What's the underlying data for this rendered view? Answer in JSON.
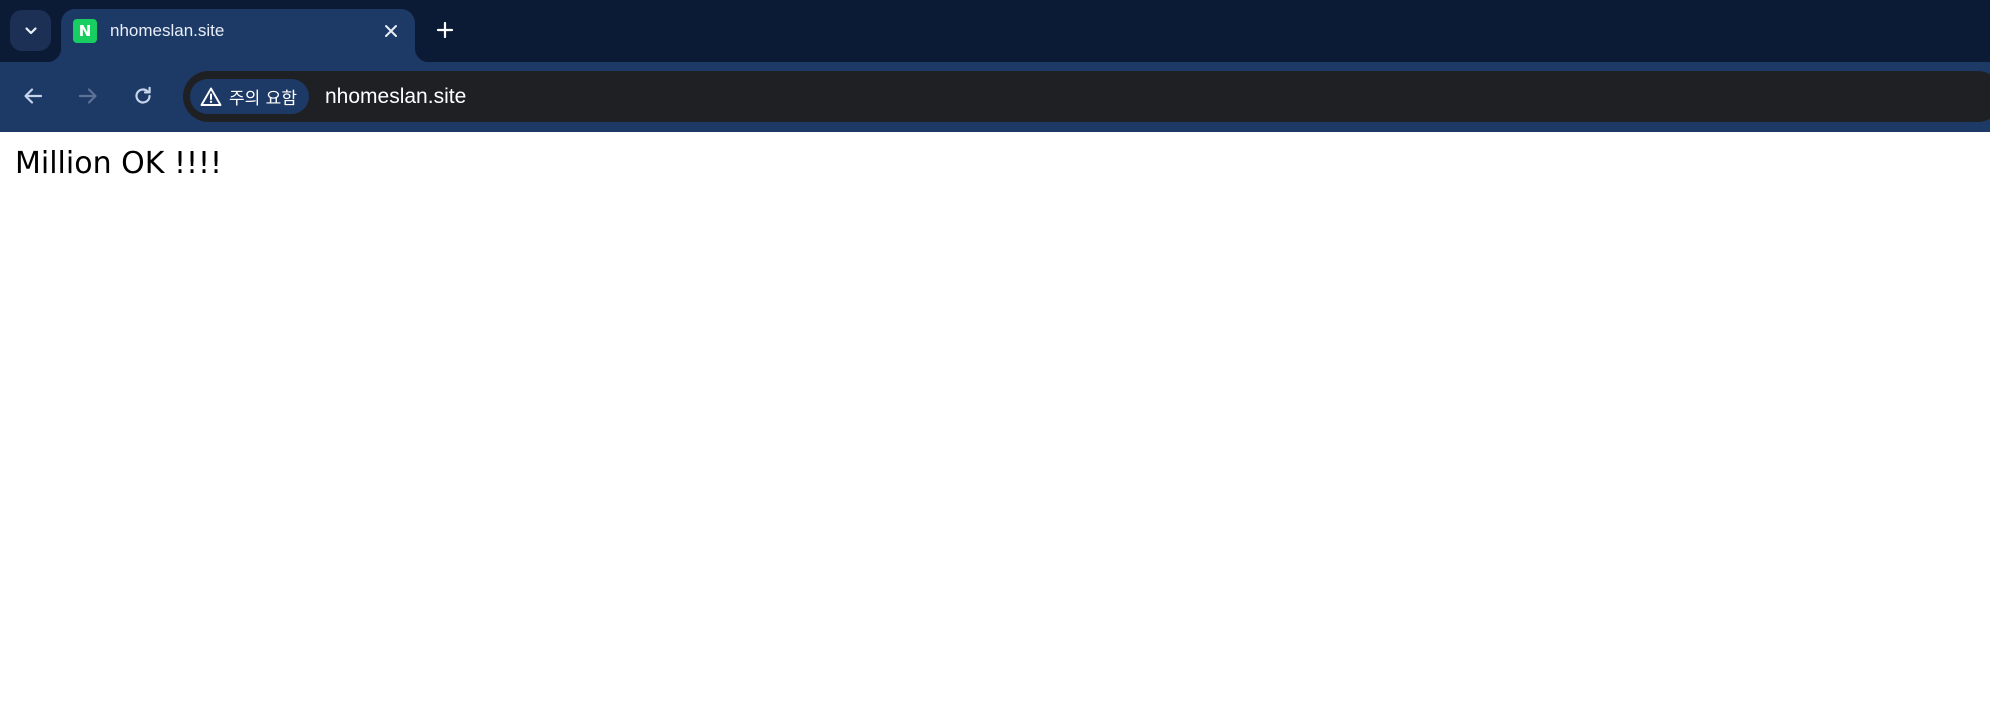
{
  "tabs": [
    {
      "title": "nhomeslan.site",
      "favicon_letter": "N",
      "active": true
    }
  ],
  "toolbar": {
    "security_chip_label": "주의 요함",
    "url": "nhomeslan.site"
  },
  "page": {
    "text": "Million OK !!!!"
  },
  "icons": {
    "tab_search": "chevron-down-icon",
    "tab_close": "close-icon",
    "new_tab": "plus-icon",
    "back": "arrow-left-icon",
    "forward": "arrow-right-icon",
    "reload": "reload-icon",
    "security_warning": "warning-triangle-icon"
  },
  "colors": {
    "tab_strip_bg": "#0b1b36",
    "toolbar_bg": "#1d3a66",
    "omnibox_bg": "#1f2023",
    "favicon_bg": "#19ce60",
    "page_bg": "#ffffff"
  }
}
